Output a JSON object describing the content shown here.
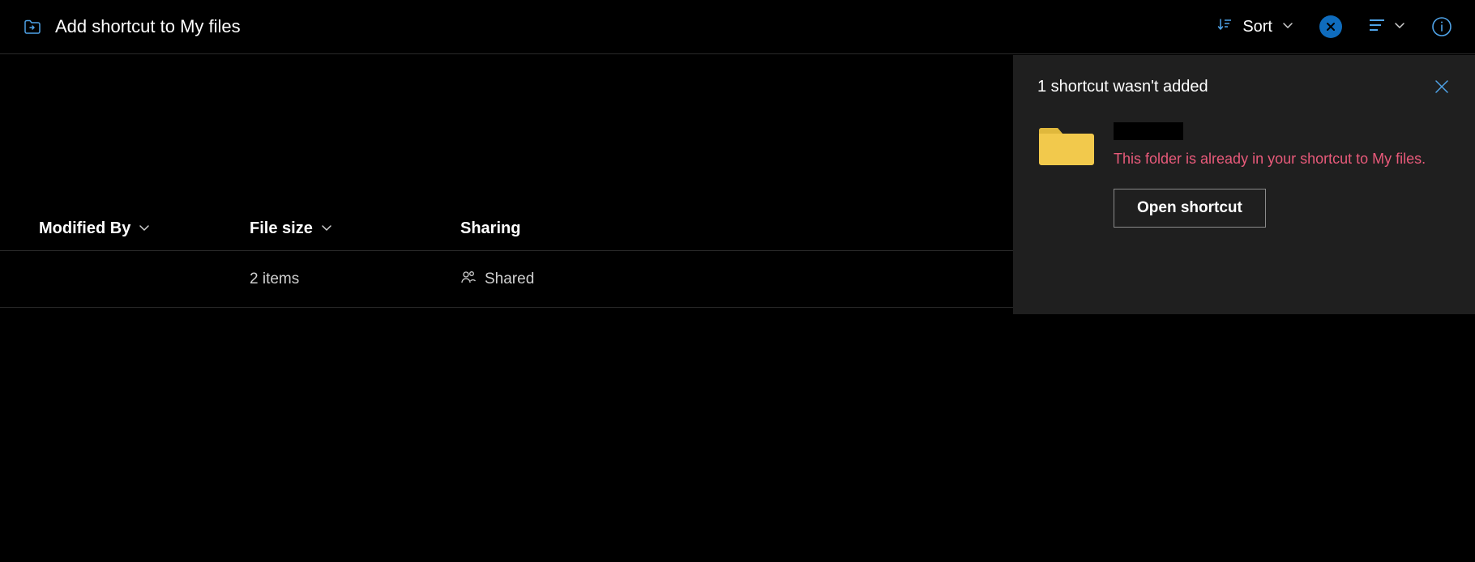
{
  "toolbar": {
    "title": "Add shortcut to My files",
    "sort_label": "Sort"
  },
  "columns": {
    "modified_by": "Modified By",
    "file_size": "File size",
    "sharing": "Sharing"
  },
  "rows": [
    {
      "modified_by": "",
      "file_size": "2 items",
      "sharing": "Shared"
    }
  ],
  "notification": {
    "title": "1 shortcut wasn't added",
    "item_name": "",
    "error_message": "This folder is already in your shortcut to My files.",
    "action_label": "Open shortcut"
  },
  "colors": {
    "accent": "#0f6cbd",
    "error_text": "#e85a7a",
    "folder_fill": "#f2c94c",
    "folder_tab": "#e0b83c"
  }
}
